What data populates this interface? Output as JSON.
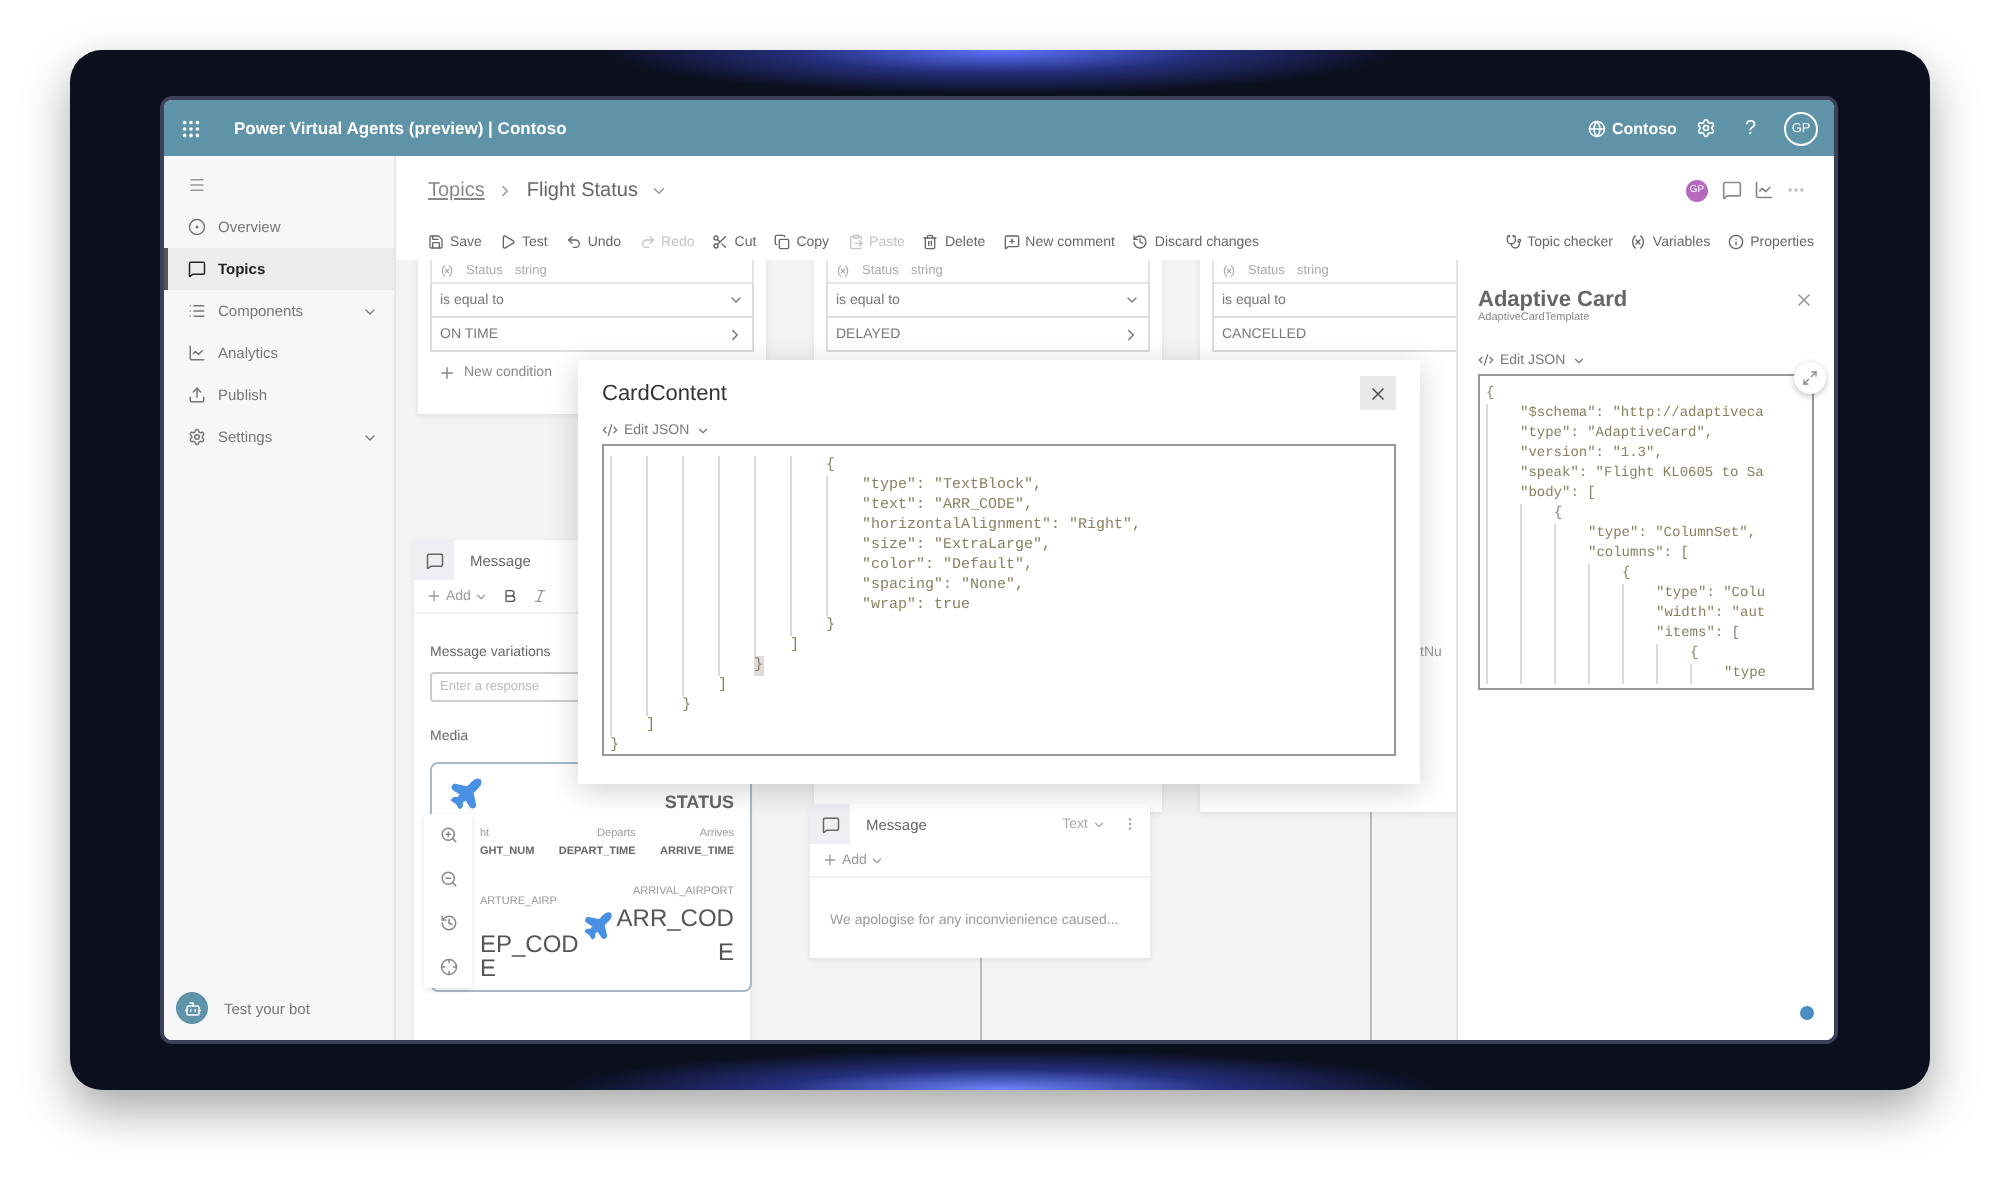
{
  "header": {
    "app_title": "Power Virtual Agents (preview) | Contoso",
    "environment": "Contoso",
    "help": "?",
    "user_initials": "GP"
  },
  "sidebar": {
    "items": [
      {
        "label": "Overview",
        "selected": false,
        "expandable": false
      },
      {
        "label": "Topics",
        "selected": true,
        "expandable": false
      },
      {
        "label": "Components",
        "selected": false,
        "expandable": true
      },
      {
        "label": "Analytics",
        "selected": false,
        "expandable": false
      },
      {
        "label": "Publish",
        "selected": false,
        "expandable": false
      },
      {
        "label": "Settings",
        "selected": false,
        "expandable": true
      }
    ],
    "footer": "Test your bot"
  },
  "breadcrumb": {
    "parent": "Topics",
    "current": "Flight Status",
    "collaborator_initials": "GP"
  },
  "toolbar": {
    "actions": [
      {
        "label": "Save",
        "disabled": false
      },
      {
        "label": "Test",
        "disabled": false
      },
      {
        "label": "Undo",
        "disabled": false
      },
      {
        "label": "Redo",
        "disabled": true
      },
      {
        "label": "Cut",
        "disabled": false
      },
      {
        "label": "Copy",
        "disabled": false
      },
      {
        "label": "Paste",
        "disabled": true
      },
      {
        "label": "Delete",
        "disabled": false
      },
      {
        "label": "New comment",
        "disabled": false
      },
      {
        "label": "Discard changes",
        "disabled": false
      }
    ],
    "panel_actions": [
      "Topic checker",
      "Variables",
      "Properties"
    ]
  },
  "canvas": {
    "conditions": [
      {
        "variable": "Status",
        "type": "string",
        "operator": "is equal to",
        "value": "ON TIME",
        "new_condition": "New condition"
      },
      {
        "variable": "Status",
        "type": "string",
        "operator": "is equal to",
        "value": "DELAYED"
      },
      {
        "variable": "Status",
        "type": "string",
        "operator": "is equal to",
        "value": "CANCELLED"
      }
    ],
    "media_message": {
      "title": "Message",
      "add": "Add",
      "variations_label": "Message variations",
      "response_placeholder": "Enter a response",
      "media_label": "Media",
      "card": {
        "status": "STATUS",
        "columns": [
          {
            "label": "ht",
            "value": "GHT_NUM"
          },
          {
            "label": "Departs",
            "value": "DEPART_TIME"
          },
          {
            "label": "Arrives",
            "value": "ARRIVE_TIME"
          }
        ],
        "departure_label": "ARTURE_AIRP",
        "departure_code": "EP_COD",
        "departure_code_rest": "E",
        "arrival_label": "ARRIVAL_AIRPORT",
        "arrival_code": "ARR_COD",
        "arrival_code_rest": "E"
      }
    },
    "text_message": {
      "title": "Message",
      "format": "Text",
      "add": "Add",
      "text": "We apologise for any inconvienience caused..."
    },
    "fragment": "tNu"
  },
  "dialog": {
    "title": "CardContent",
    "mode": "Edit JSON",
    "code": [
      {
        "line": "                        {",
        "matched": false
      },
      {
        "line": "                            \"type\": \"TextBlock\",",
        "matched": false
      },
      {
        "line": "                            \"text\": \"ARR_CODE\",",
        "matched": false
      },
      {
        "line": "                            \"horizontalAlignment\": \"Right\",",
        "matched": false
      },
      {
        "line": "                            \"size\": \"ExtraLarge\",",
        "matched": false
      },
      {
        "line": "                            \"color\": \"Default\",",
        "matched": false
      },
      {
        "line": "                            \"spacing\": \"None\",",
        "matched": false
      },
      {
        "line": "                            \"wrap\": true",
        "matched": false
      },
      {
        "line": "                        }",
        "matched": false
      },
      {
        "line": "                    ]",
        "matched": false
      },
      {
        "line": "                }",
        "matched": true
      },
      {
        "line": "            ]",
        "matched": false
      },
      {
        "line": "        }",
        "matched": false
      },
      {
        "line": "    ]",
        "matched": false
      },
      {
        "line": "}",
        "matched": false
      }
    ]
  },
  "panel": {
    "title": "Adaptive Card",
    "subtitle": "AdaptiveCardTemplate",
    "mode": "Edit JSON",
    "code": [
      "{",
      "    \"$schema\": \"http://adaptiveca",
      "    \"type\": \"AdaptiveCard\",",
      "    \"version\": \"1.3\",",
      "    \"speak\": \"Flight KL0605 to Sa",
      "    \"body\": [",
      "        {",
      "            \"type\": \"ColumnSet\",",
      "            \"columns\": [",
      "                {",
      "                    \"type\": \"Colu",
      "                    \"width\": \"aut",
      "                    \"items\": [",
      "                        {",
      "                            \"type"
    ]
  }
}
